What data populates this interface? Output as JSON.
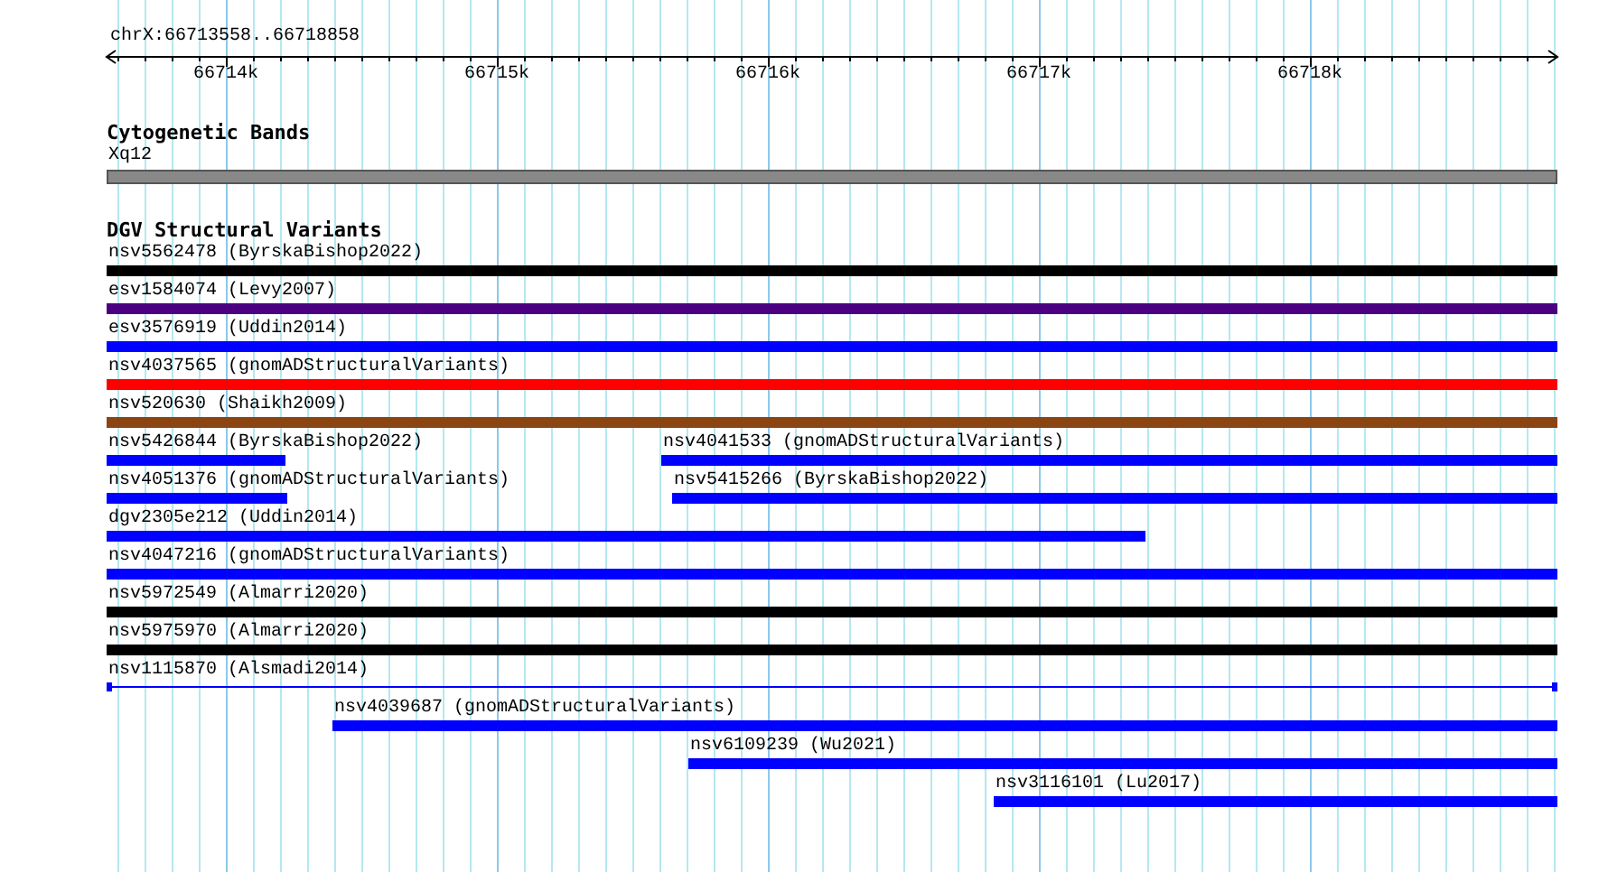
{
  "ruler": {
    "position": "chrX:66713558..66718858",
    "ticks": [
      "66714k",
      "66715k",
      "66716k",
      "66717k",
      "66718k"
    ]
  },
  "tracks": [
    {
      "title": "Cytogenetic Bands",
      "rows": [
        [
          {
            "label": "Xq12",
            "color": "#888888",
            "kind": "band"
          }
        ]
      ]
    },
    {
      "title": "DGV Structural Variants",
      "rows": [
        [
          {
            "label": "nsv5562478 (ByrskaBishop2022)",
            "color": "#000000",
            "kind": "bar"
          }
        ],
        [
          {
            "label": "esv1584074 (Levy2007)",
            "color": "#4b0082",
            "kind": "bar"
          }
        ],
        [
          {
            "label": "esv3576919 (Uddin2014)",
            "color": "#0000ff",
            "kind": "bar"
          }
        ],
        [
          {
            "label": "nsv4037565 (gnomADStructuralVariants)",
            "color": "#ff0000",
            "kind": "bar"
          }
        ],
        [
          {
            "label": "nsv520630 (Shaikh2009)",
            "color": "#8b4513",
            "kind": "bar"
          }
        ],
        [
          {
            "label": "nsv5426844 (ByrskaBishop2022)",
            "color": "#0000ff",
            "kind": "bar"
          },
          {
            "label": "nsv4041533 (gnomADStructuralVariants)",
            "color": "#0000ff",
            "kind": "bar"
          }
        ],
        [
          {
            "label": "nsv4051376 (gnomADStructuralVariants)",
            "color": "#0000ff",
            "kind": "bar"
          },
          {
            "label": "nsv5415266 (ByrskaBishop2022)",
            "color": "#0000ff",
            "kind": "bar"
          }
        ],
        [
          {
            "label": "dgv2305e212 (Uddin2014)",
            "color": "#0000ff",
            "kind": "bar"
          }
        ],
        [
          {
            "label": "nsv4047216 (gnomADStructuralVariants)",
            "color": "#0000ff",
            "kind": "bar"
          }
        ],
        [
          {
            "label": "nsv5972549 (Almarri2020)",
            "color": "#000000",
            "kind": "bar"
          }
        ],
        [
          {
            "label": "nsv5975970 (Almarri2020)",
            "color": "#000000",
            "kind": "bar"
          }
        ],
        [
          {
            "label": "nsv1115870 (Alsmadi2014)",
            "color": "#0000ff",
            "kind": "line"
          }
        ],
        [
          {
            "label": "nsv4039687 (gnomADStructuralVariants)",
            "color": "#0000ff",
            "kind": "bar"
          }
        ],
        [
          {
            "label": "nsv6109239 (Wu2021)",
            "color": "#0000ff",
            "kind": "bar"
          }
        ],
        [
          {
            "label": "nsv3116101 (Lu2017)",
            "color": "#0000ff",
            "kind": "bar"
          }
        ]
      ]
    }
  ]
}
